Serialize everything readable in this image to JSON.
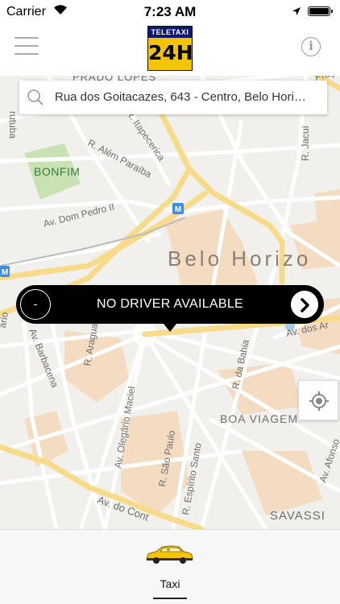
{
  "status_bar": {
    "carrier": "Carrier",
    "time": "7:23 AM"
  },
  "header": {
    "logo_top": "TELETAXI",
    "logo_main": "24H"
  },
  "search": {
    "value": "Rua dos Goitacazes, 643 - Centro, Belo Hori…"
  },
  "map": {
    "labels": {
      "prado_lopes": "PRADO LOPES",
      "praca": "Praça",
      "rutuba": "rutuba",
      "bonfim": "BONFIM",
      "itapecerica": "R. Itapecerica",
      "alem_paraiba": "R. Além Paraíba",
      "dom_pedro": "Av. Dom Pedro II",
      "jacui": "R. Jacuí",
      "belo_horizonte": "Belo Horizo",
      "avenida_dos": "Av. dos Ar",
      "aragua": "R. Aragua",
      "barbacena": "Av. Barbacena",
      "olegario": "Av. Olegário Maciel",
      "da_bahia": "R. da Bahia",
      "boa_viagem": "BOA VIAGEM",
      "sao_paulo": "R. São Paulo",
      "espirito_santo": "R. Espírito Santo",
      "afonso": "Av. Afonso",
      "av_do_cont": "Av. do Cont",
      "savassi": "SAVASSI",
      "mario": "ário",
      "metro1": "M",
      "metro2": "M"
    }
  },
  "driver_panel": {
    "left_button": "-",
    "message": "NO DRIVER AVAILABLE"
  },
  "tab_bar": {
    "taxi_label": "Taxi"
  },
  "colors": {
    "logo_yellow": "#f4c400",
    "logo_blue": "#0b1a6f",
    "road_yellow": "#f6dc8a",
    "urban_area": "#f3dcc1",
    "park_green": "#c9e2b4"
  }
}
